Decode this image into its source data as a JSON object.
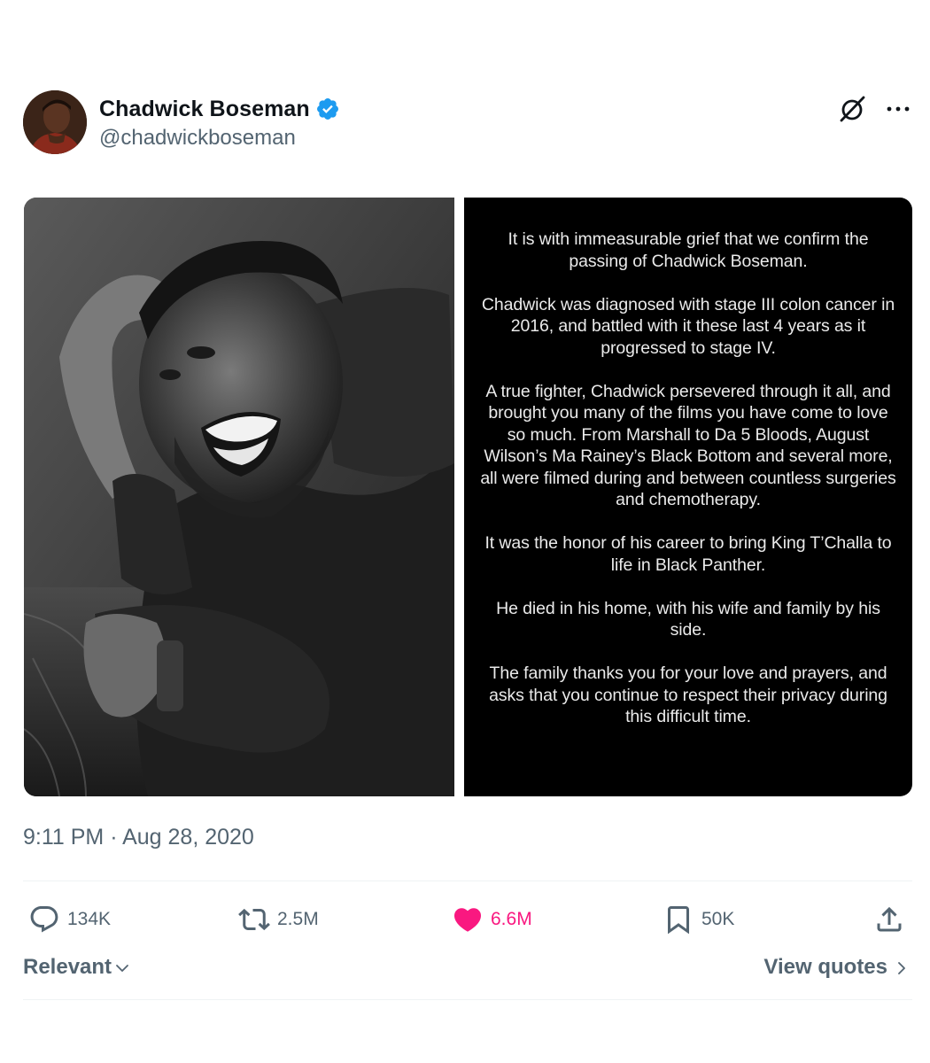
{
  "author": {
    "display_name": "Chadwick Boseman",
    "handle": "@chadwickboseman",
    "verified_color": "#1d9bf0"
  },
  "header_icons": [
    "grok-icon",
    "more-icon"
  ],
  "media": {
    "statement_paragraphs": [
      "It is with immeasurable grief that we confirm the passing of Chadwick Boseman.",
      "Chadwick was diagnosed with stage III colon cancer in 2016, and battled with it these last 4 years as it progressed to stage IV.",
      "A true fighter, Chadwick persevered through it all, and brought you many of the films you have come to love so much. From Marshall to Da 5 Bloods, August Wilson’s Ma Rainey’s Black Bottom and several more, all were filmed during and between countless surgeries and chemotherapy.",
      "It was the honor of his career to bring King T’Challa to life in Black Panther.",
      "He died in his home, with his wife and family by his side.",
      "The family thanks you for your love and prayers, and asks that you continue to respect their privacy during this difficult time."
    ]
  },
  "timestamp": "9:11 PM · Aug 28, 2020",
  "actions": {
    "replies": "134K",
    "reposts": "2.5M",
    "likes": "6.6M",
    "bookmarks": "50K",
    "like_color": "#f91880"
  },
  "replies_bar": {
    "sort_label": "Relevant",
    "quotes_label": "View quotes"
  }
}
